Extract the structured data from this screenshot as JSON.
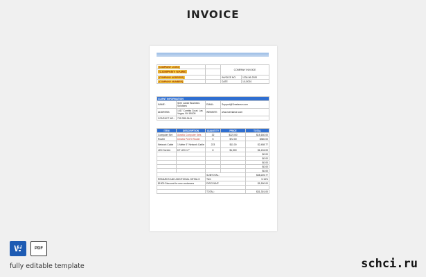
{
  "page_title": "INVOICE",
  "header": {
    "company_logo": "[COMPANY LOGO]",
    "company_name": "[COMPANY NAME]",
    "company_address": "[COMPANY ADDRESS]",
    "company_number": "[COMPANY NUMBER]",
    "invoice_title": "COMPANY INVOICE",
    "invoice_no_label": "INVOICE NO.",
    "invoice_no_value": "1234-56-2020",
    "date_label": "DATE",
    "date_value": "1/1/2020"
  },
  "client": {
    "section_label": "CLIENT INFORMATION",
    "name_label": "NAME:",
    "name_value": "Sree Lanse Business Solutions",
    "email_label": "EMAIL:",
    "email_value": "Support@Sreelanse.com",
    "address_label": "ADDRESS:",
    "address_value": "1417 Cumbia Court, Las Vegas, NV 89109",
    "website_label": "WEBSITE:",
    "website_value": "www.sreelanse.com",
    "contact_label": "CONTACT NO.:",
    "contact_value": "702-305-2441"
  },
  "items": {
    "headers": [
      "ITEM",
      "DESCRIPTION",
      "QUANTITY",
      "PRICE",
      "TOTAL"
    ],
    "rows": [
      {
        "item": "Computer Set",
        "desc": "Aksella Computer Sets",
        "qty": "32",
        "price": "$32,000",
        "total": "$15,180.00"
      },
      {
        "item": "Router",
        "desc": "Dinatra PL570 Router",
        "qty": "5",
        "price": "$72.00",
        "total": "$360.00"
      },
      {
        "item": "Network Cable",
        "desc": "1 Meter 3\" Network Cable",
        "qty": "223",
        "price": "$11.00",
        "total": "$2,458.77"
      },
      {
        "item": "LED Screen",
        "desc": "DT LED 17\"",
        "qty": "8",
        "price": "$1,500",
        "total": "$1,216.00"
      },
      {
        "item": "",
        "desc": "",
        "qty": "",
        "price": "",
        "total": "$0.00"
      },
      {
        "item": "",
        "desc": "",
        "qty": "",
        "price": "",
        "total": "$0.00"
      },
      {
        "item": "",
        "desc": "",
        "qty": "",
        "price": "",
        "total": "$0.00"
      },
      {
        "item": "",
        "desc": "",
        "qty": "",
        "price": "",
        "total": "$0.00"
      },
      {
        "item": "",
        "desc": "",
        "qty": "",
        "price": "",
        "total": "$0.00"
      }
    ]
  },
  "summary": {
    "subtotal_label": "SUBTOTAL:",
    "subtotal_value": "$38,225.77",
    "remarks_label": "REMARKS AND ADDITIONAL DETAILS",
    "tax_label": "TAX:",
    "tax_value": "5.15%",
    "remark_text": "$1500 Discount for new customers",
    "discount_label": "DISCOUNT:",
    "discount_value": "$1,500.00",
    "total_label": "TOTAL:",
    "total_value": "$31,301.00"
  },
  "footer": {
    "word_badge": "W",
    "pdf_badge": "PDF",
    "caption": "fully editable template",
    "site": "schci.ru"
  },
  "colors": {
    "accent": "#2f6fd1",
    "highlight": "#f5c93d",
    "background": "#f0f0f0"
  }
}
